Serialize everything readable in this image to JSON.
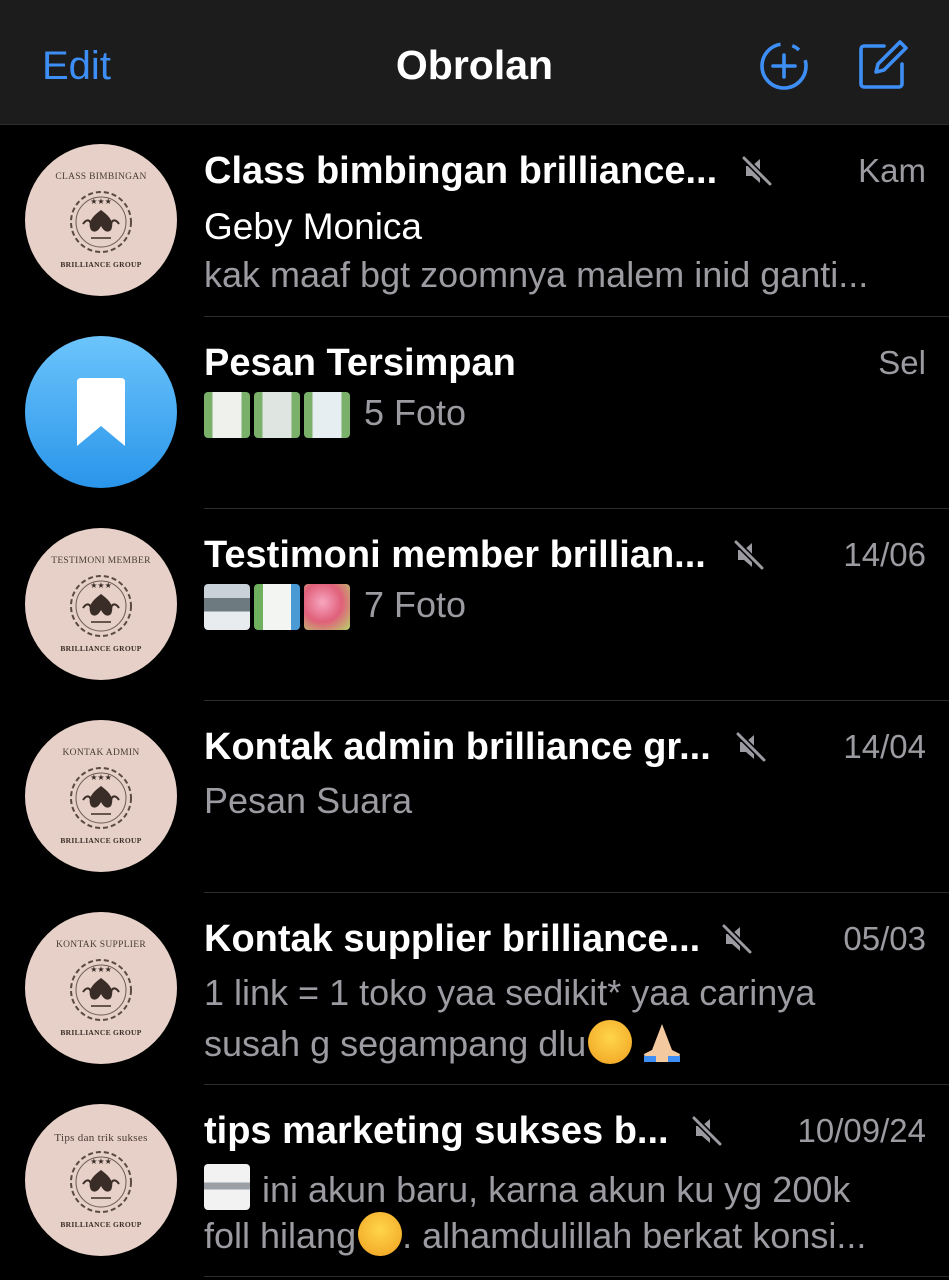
{
  "header": {
    "edit_label": "Edit",
    "title": "Obrolan",
    "accent_color": "#3d8ff5"
  },
  "avatar_brand": "BRILLIANCE GROUP",
  "chats": [
    {
      "avatar_caption": "CLASS BIMBINGAN",
      "name": "Class bimbingan brilliance...",
      "muted": true,
      "time": "Kam",
      "sender": "Geby Monica",
      "preview": "kak maaf bgt zoomnya malem inid ganti..."
    },
    {
      "avatar_icon": "bookmark-icon",
      "name": "Pesan Tersimpan",
      "muted": false,
      "time": "Sel",
      "preview": "5 Foto"
    },
    {
      "avatar_caption": "TESTIMONI MEMBER",
      "name": "Testimoni member brillian...",
      "muted": true,
      "time": "14/06",
      "preview": "7 Foto"
    },
    {
      "avatar_caption": "KONTAK ADMIN",
      "name": "Kontak admin brilliance gr...",
      "muted": true,
      "time": "14/04",
      "preview": "Pesan Suara"
    },
    {
      "avatar_caption": "KONTAK SUPPLIER",
      "name": "Kontak supplier brilliance...",
      "muted": true,
      "time": "05/03",
      "preview_line1": "1 link = 1 toko yaa sedikit* yaa carinya",
      "preview_line2": "susah g segampang dlu"
    },
    {
      "avatar_caption": "Tips dan trik sukses",
      "name": "tips marketing sukses b...",
      "muted": true,
      "time": "10/09/24",
      "preview_line1": "ini akun baru, karna akun ku yg 200k",
      "preview_line2a": "foll hilang",
      "preview_line2b": ". alhamdulillah berkat konsi..."
    }
  ]
}
